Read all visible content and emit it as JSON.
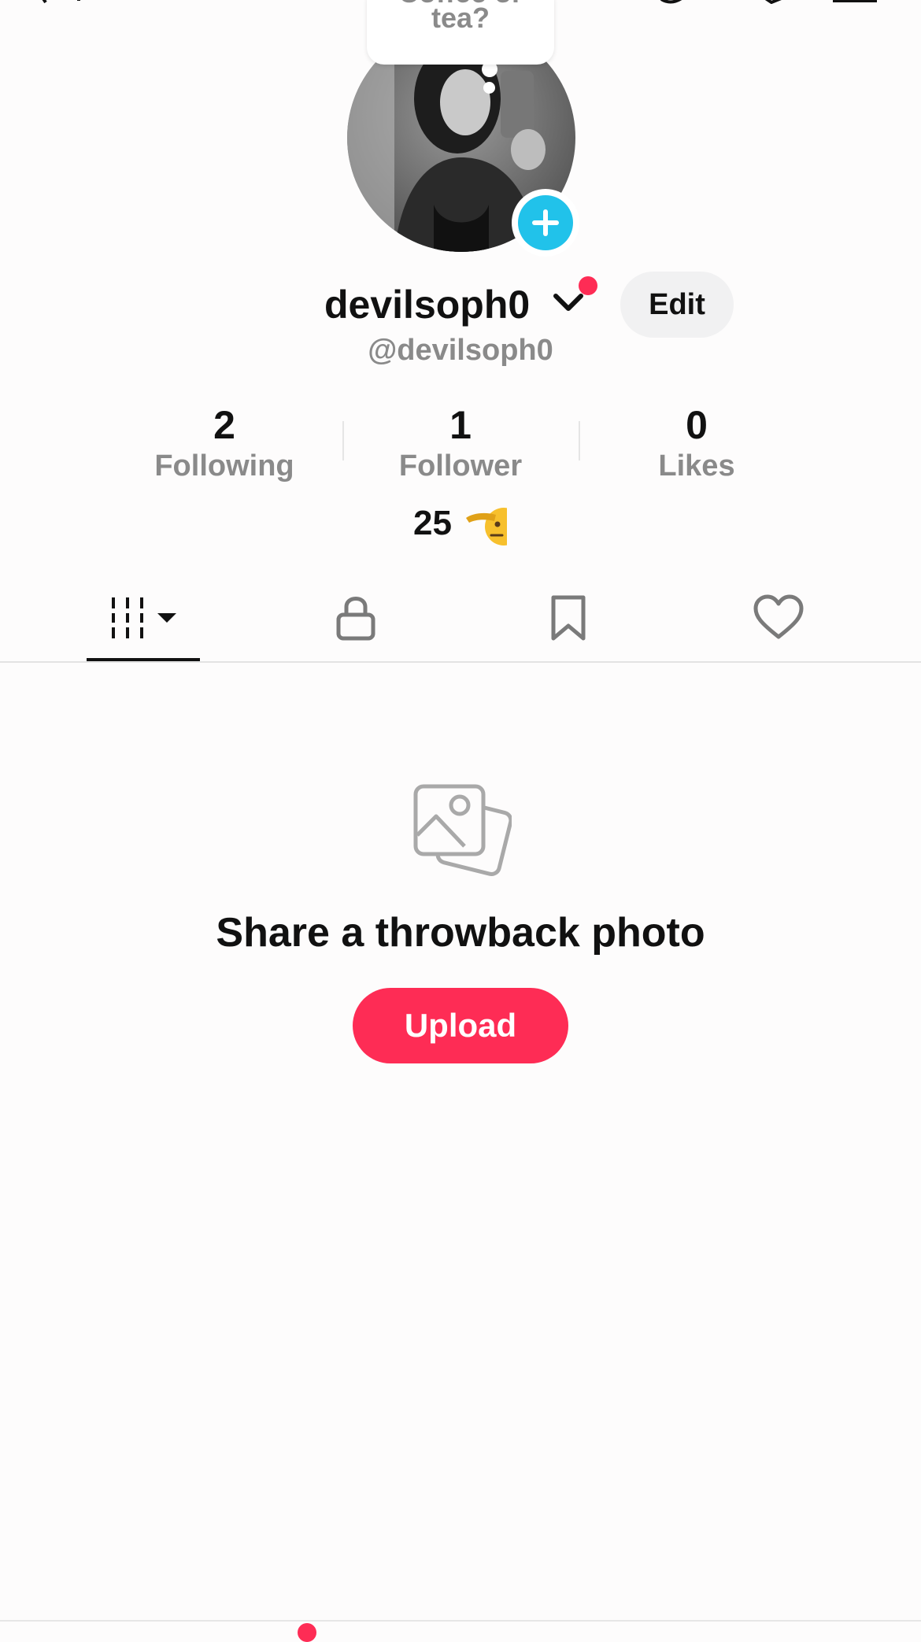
{
  "note": {
    "line1": "Coffee or",
    "line2": "tea?"
  },
  "profile": {
    "username": "devilsoph0",
    "handle": "@devilsoph0",
    "edit_label": "Edit"
  },
  "stats": [
    {
      "value": "2",
      "label": "Following"
    },
    {
      "value": "1",
      "label": "Follower"
    },
    {
      "value": "0",
      "label": "Likes"
    }
  ],
  "bio": {
    "text": "25",
    "emoji": "saluting-face"
  },
  "tabs": [
    {
      "icon": "grid-icon",
      "selected": true
    },
    {
      "icon": "lock-icon",
      "selected": false
    },
    {
      "icon": "bookmark-icon",
      "selected": false
    },
    {
      "icon": "heart-icon",
      "selected": false
    }
  ],
  "empty_state": {
    "title": "Share a throwback photo",
    "upload_label": "Upload",
    "icon": "photos-icon"
  },
  "colors": {
    "accent": "#fe2c55",
    "badge": "#21c2ea",
    "muted": "#8a8a8a"
  }
}
